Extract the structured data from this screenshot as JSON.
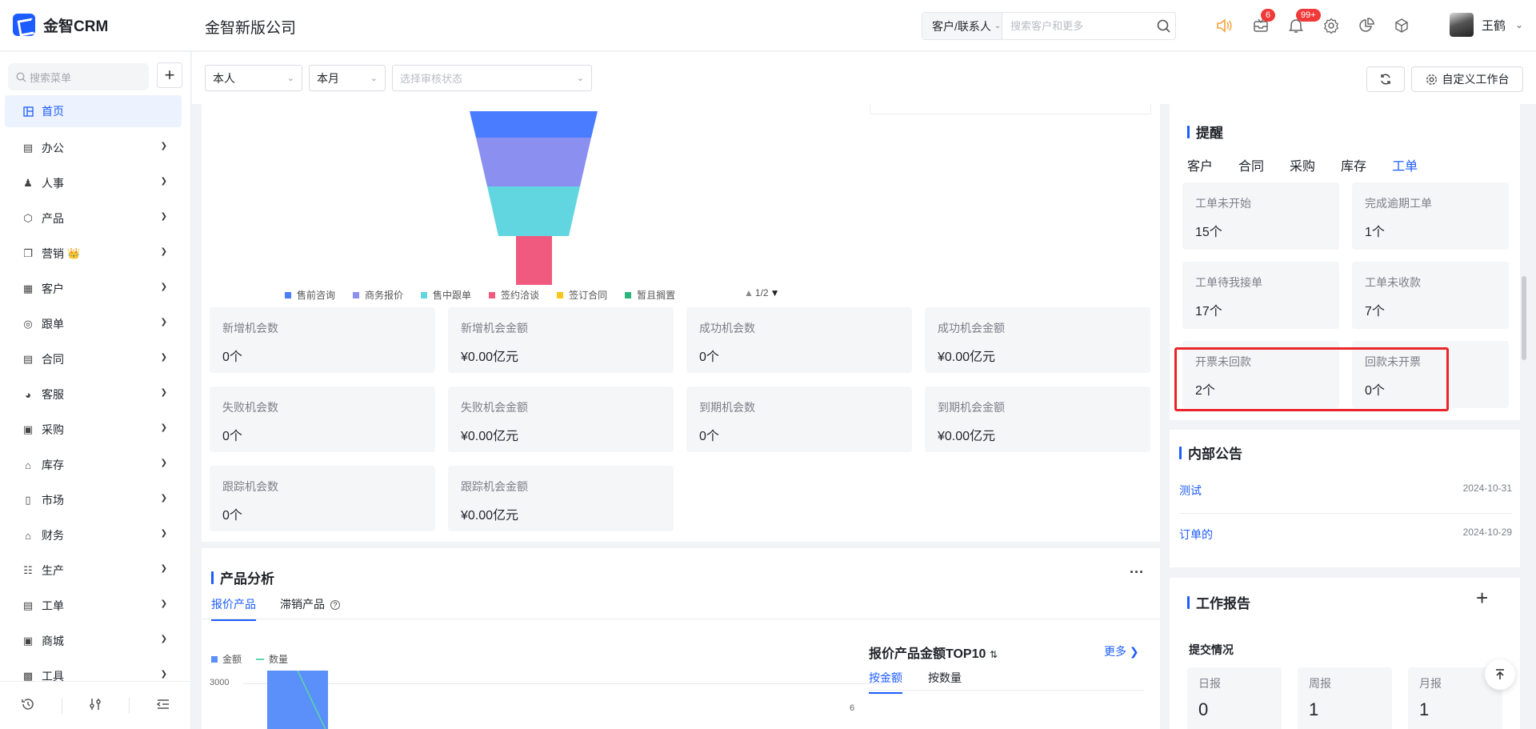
{
  "app": {
    "logo_text": "金智CRM",
    "company": "金智新版公司",
    "brand_color": "#1c5cff"
  },
  "search": {
    "type_label": "客户/联系人",
    "placeholder": "搜索客户和更多"
  },
  "notifications": {
    "mail_badge": "6",
    "bell_badge": "99+"
  },
  "user": {
    "name": "王鹤"
  },
  "sidebar": {
    "search_placeholder": "搜索菜单",
    "add_label": "+",
    "items": [
      {
        "label": "首页",
        "icon": "dashboard-icon",
        "active": true
      },
      {
        "label": "办公",
        "icon": "office-icon"
      },
      {
        "label": "人事",
        "icon": "people-icon"
      },
      {
        "label": "产品",
        "icon": "cube-icon"
      },
      {
        "label": "营销",
        "icon": "copy-icon",
        "crown": "👑"
      },
      {
        "label": "客户",
        "icon": "building-icon"
      },
      {
        "label": "跟单",
        "icon": "target-icon"
      },
      {
        "label": "合同",
        "icon": "contract-icon"
      },
      {
        "label": "客服",
        "icon": "headset-icon"
      },
      {
        "label": "采购",
        "icon": "bag-icon"
      },
      {
        "label": "库存",
        "icon": "warehouse-icon"
      },
      {
        "label": "市场",
        "icon": "book-icon"
      },
      {
        "label": "财务",
        "icon": "finance-icon"
      },
      {
        "label": "生产",
        "icon": "factory-icon"
      },
      {
        "label": "工单",
        "icon": "ticket-icon"
      },
      {
        "label": "商城",
        "icon": "shop-icon"
      },
      {
        "label": "工具",
        "icon": "toolbox-icon"
      }
    ]
  },
  "filters": {
    "person": "本人",
    "period": "本月",
    "audit_placeholder": "选择审核状态",
    "custom_label": "自定义工作台"
  },
  "funnel": {
    "legend": [
      {
        "label": "售前咨询",
        "color": "#4a7cff"
      },
      {
        "label": "商务报价",
        "color": "#8b90f0"
      },
      {
        "label": "售中跟单",
        "color": "#62d6e0"
      },
      {
        "label": "签约洽谈",
        "color": "#f05a7e"
      },
      {
        "label": "签订合同",
        "color": "#f8c61a"
      },
      {
        "label": "暂且搁置",
        "color": "#2ab57d"
      }
    ],
    "pager": "1/2",
    "stats": [
      {
        "label": "新增机会数",
        "value": "0个"
      },
      {
        "label": "新增机会金额",
        "value": "¥0.00亿元"
      },
      {
        "label": "成功机会数",
        "value": "0个"
      },
      {
        "label": "成功机会金额",
        "value": "¥0.00亿元"
      },
      {
        "label": "失败机会数",
        "value": "0个"
      },
      {
        "label": "失败机会金额",
        "value": "¥0.00亿元"
      },
      {
        "label": "到期机会数",
        "value": "0个"
      },
      {
        "label": "到期机会金额",
        "value": "¥0.00亿元"
      },
      {
        "label": "跟踪机会数",
        "value": "0个"
      },
      {
        "label": "跟踪机会金额",
        "value": "¥0.00亿元"
      }
    ]
  },
  "product": {
    "title": "产品分析",
    "more": "···",
    "tabs": [
      "报价产品",
      "滞销产品"
    ],
    "legend_amount": "金额",
    "legend_qty": "数量",
    "y_tick": "3000",
    "y2_tick": "6",
    "top10_title": "报价产品金额TOP10",
    "top10_more": "更多",
    "top10_tabs": [
      "按金额",
      "按数量"
    ]
  },
  "remind": {
    "title": "提醒",
    "tabs": [
      "客户",
      "合同",
      "采购",
      "库存",
      "工单"
    ],
    "active_tab": "工单",
    "cards": [
      {
        "label": "工单未开始",
        "value": "15个"
      },
      {
        "label": "完成逾期工单",
        "value": "1个"
      },
      {
        "label": "工单待我接单",
        "value": "17个"
      },
      {
        "label": "工单未收款",
        "value": "7个"
      },
      {
        "label": "开票未回款",
        "value": "2个"
      },
      {
        "label": "回款未开票",
        "value": "0个"
      }
    ]
  },
  "notice": {
    "title": "内部公告",
    "items": [
      {
        "title": "测试",
        "date": "2024-10-31"
      },
      {
        "title": "订单的",
        "date": "2024-10-29"
      }
    ]
  },
  "report": {
    "title": "工作报告",
    "add": "+",
    "subtitle": "提交情况",
    "cards": [
      {
        "label": "日报",
        "value": "0"
      },
      {
        "label": "周报",
        "value": "1"
      },
      {
        "label": "月报",
        "value": "1"
      }
    ]
  }
}
